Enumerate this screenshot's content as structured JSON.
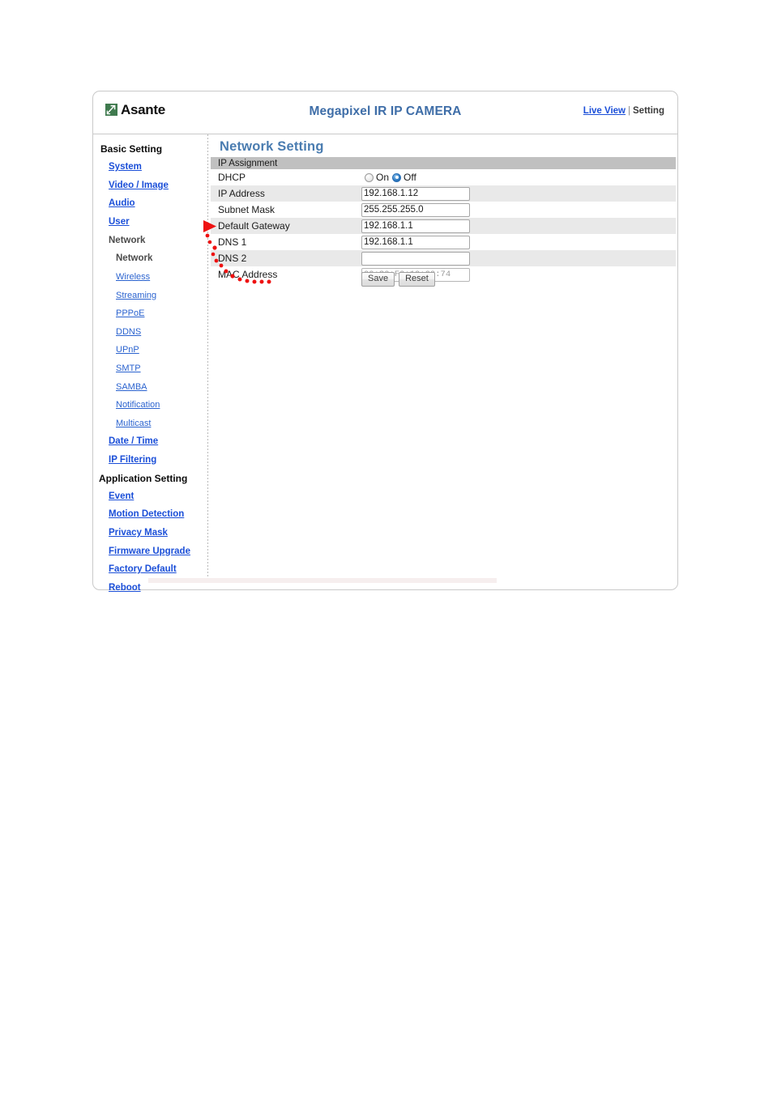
{
  "header": {
    "brand_name": "Asante",
    "brand_mark_icon": "asante-green-slash-logo",
    "title": "Megapixel IR IP CAMERA",
    "live_view_label": "Live View",
    "separator": "|",
    "setting_label": "Setting"
  },
  "sidebar": {
    "items": [
      {
        "label": "Basic Setting",
        "type": "heading"
      },
      {
        "label": "System",
        "type": "link"
      },
      {
        "label": "Video / Image",
        "type": "link"
      },
      {
        "label": "Audio",
        "type": "link"
      },
      {
        "label": "User",
        "type": "link"
      },
      {
        "label": "Network",
        "type": "static"
      },
      {
        "label": "Network",
        "type": "static-sub"
      },
      {
        "label": "Wireless",
        "type": "link-sub"
      },
      {
        "label": "Streaming",
        "type": "link-sub"
      },
      {
        "label": "PPPoE",
        "type": "link-sub"
      },
      {
        "label": "DDNS",
        "type": "link-sub"
      },
      {
        "label": "UPnP",
        "type": "link-sub"
      },
      {
        "label": "SMTP",
        "type": "link-sub"
      },
      {
        "label": "SAMBA",
        "type": "link-sub"
      },
      {
        "label": "Notification",
        "type": "link-sub"
      },
      {
        "label": "Multicast",
        "type": "link-sub"
      },
      {
        "label": "Date / Time",
        "type": "link"
      },
      {
        "label": "IP Filtering",
        "type": "link"
      },
      {
        "label": "Application Setting",
        "type": "heading-app"
      },
      {
        "label": "Event",
        "type": "link"
      },
      {
        "label": "Motion Detection",
        "type": "link"
      },
      {
        "label": "Privacy Mask",
        "type": "link"
      },
      {
        "label": "Firmware Upgrade",
        "type": "link"
      },
      {
        "label": "Factory Default",
        "type": "link"
      },
      {
        "label": "Reboot",
        "type": "link"
      }
    ]
  },
  "main": {
    "page_title": "Network Setting",
    "section_label": "IP Assignment",
    "rows": [
      {
        "label": "DHCP",
        "kind": "radio",
        "shade": false,
        "options": [
          {
            "label": "On",
            "selected": false
          },
          {
            "label": "Off",
            "selected": true
          }
        ]
      },
      {
        "label": "IP Address",
        "kind": "text",
        "shade": true,
        "value": "192.168.1.12",
        "disabled": false
      },
      {
        "label": "Subnet Mask",
        "kind": "text",
        "shade": false,
        "value": "255.255.255.0",
        "disabled": false
      },
      {
        "label": "Default Gateway",
        "kind": "text",
        "shade": true,
        "value": "192.168.1.1",
        "disabled": false
      },
      {
        "label": "DNS 1",
        "kind": "text",
        "shade": false,
        "value": "192.168.1.1",
        "disabled": false
      },
      {
        "label": "DNS 2",
        "kind": "text",
        "shade": true,
        "value": "",
        "disabled": false
      },
      {
        "label": "MAC Address",
        "kind": "text",
        "shade": false,
        "value": "00:30:F0:10:00:74",
        "disabled": true
      }
    ],
    "save_label": "Save",
    "reset_label": "Reset"
  },
  "annotation": {
    "kind": "hand-drawn-red-arrow-with-dot-trail",
    "color": "#ee1111",
    "points_at": "Default Gateway"
  }
}
